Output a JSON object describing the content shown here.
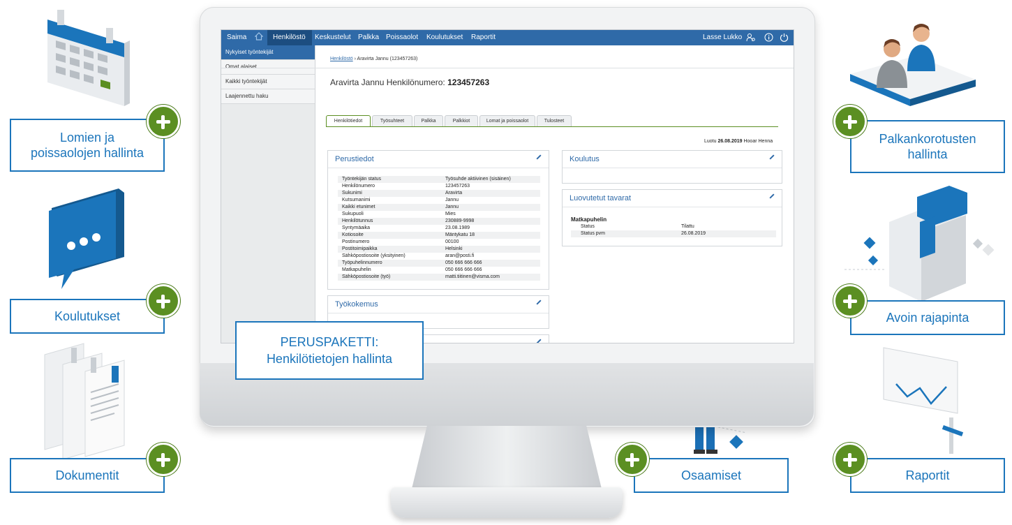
{
  "features": {
    "left": [
      {
        "label_line1": "Lomien ja",
        "label_line2": "poissaolojen hallinta"
      },
      {
        "label": "Koulutukset"
      },
      {
        "label": "Dokumentit"
      }
    ],
    "right": [
      {
        "label_line1": "Palkankorotusten",
        "label_line2": "hallinta"
      },
      {
        "label": "Avoin rajapinta"
      },
      {
        "label": "Raportit"
      }
    ],
    "bottom": {
      "label": "Osaamiset"
    }
  },
  "peruspaketti": {
    "line1": "PERUSPAKETTI:",
    "line2": "Henkilötietojen hallinta"
  },
  "app": {
    "nav": {
      "brand": "Saima",
      "items": [
        "Henkilöstö",
        "Keskustelut",
        "Palkka",
        "Poissaolot",
        "Koulutukset",
        "Raportit"
      ],
      "user": "Lasse Lukko"
    },
    "sidebar": [
      "Nykyiset työntekijät",
      "Omat alaiset",
      "Kaikki työntekijät",
      "Laajennettu haku"
    ],
    "breadcrumb": {
      "root": "Henkilöstö",
      "separator": "›",
      "current": "Aravirta Jannu (123457263)"
    },
    "title": {
      "prefix": "Aravirta Jannu Henkilönumero:",
      "number": "123457263"
    },
    "tabs": [
      "Henkilötiedot",
      "Työsuhteet",
      "Palkka",
      "Palkkiot",
      "Lomat ja poissaolot",
      "Tulosteet"
    ],
    "created": {
      "prefix": "Luotu",
      "date": "26.08.2019",
      "by": "Hooar Henna"
    },
    "perustiedot": {
      "heading": "Perustiedot",
      "rows": [
        [
          "Työntekijän status",
          "Työsuhde aktiivinen (sisäinen)"
        ],
        [
          "Henkilönumero",
          "123457263"
        ],
        [
          "Sukunimi",
          "Aravirta"
        ],
        [
          "Kutsumanimi",
          "Jannu"
        ],
        [
          "Kaikki etunimet",
          "Jannu"
        ],
        [
          "Sukupuoli",
          "Mies"
        ],
        [
          "Henkilötunnus",
          "230889-9998"
        ],
        [
          "Syntymäaika",
          "23.08.1989"
        ],
        [
          "Kotiosoite",
          "Mäntykatu 18"
        ],
        [
          "Postinumero",
          "00100"
        ],
        [
          "Postitoimipaikka",
          "Helsinki"
        ],
        [
          "Sähköpostiosoite (yksityinen)",
          "aran@posti.fi"
        ],
        [
          "Työpuhelinnumero",
          "050 666 666 666"
        ],
        [
          "Matkapuhelin",
          "050 666 666 666"
        ],
        [
          "Sähköpostiosoite (työ)",
          "matti.tiitinen@visma.com"
        ]
      ]
    },
    "tyokokemus": {
      "heading": "Työkokemus"
    },
    "koulutus": {
      "heading": "Koulutus"
    },
    "luovutetut": {
      "heading": "Luovutetut tavarat",
      "item": "Matkapuhelin",
      "rows": [
        [
          "Status",
          "Tilattu"
        ],
        [
          "Status pvm",
          "26.08.2019"
        ]
      ]
    }
  },
  "colors": {
    "accent": "#1b75bb",
    "plus": "#5b8f22",
    "nav": "#2f6aa8"
  }
}
